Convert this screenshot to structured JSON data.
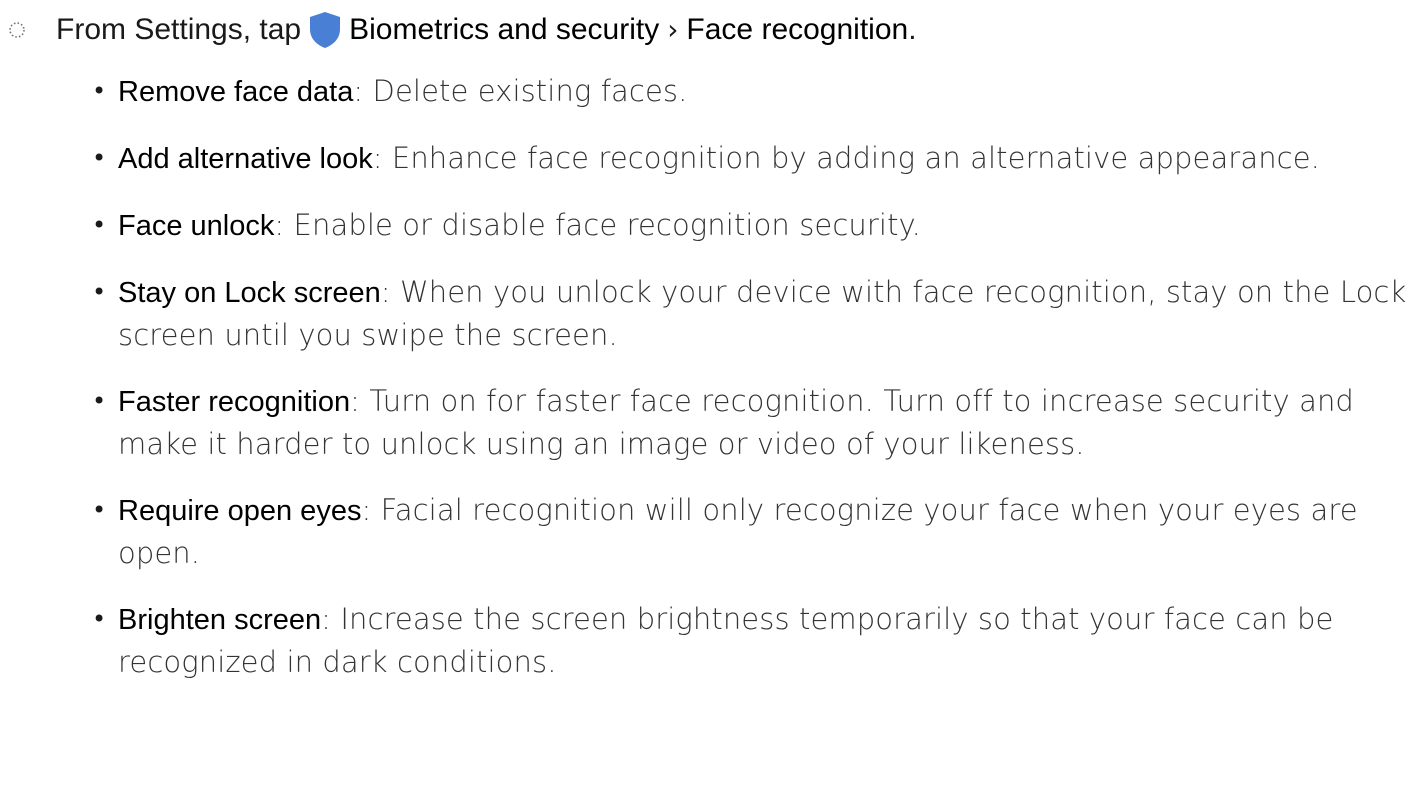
{
  "step": {
    "prefix": "From Settings, tap",
    "menu_item": "Biometrics and security",
    "separator": "›",
    "submenu_item": "Face recognition",
    "suffix": "."
  },
  "icons": {
    "step_marker": "dotted-circle-icon",
    "settings_icon": "shield-icon",
    "shield_color": "#4a7fd6"
  },
  "options": [
    {
      "term": "Remove face data",
      "desc": ": Delete existing faces."
    },
    {
      "term": "Add alternative look",
      "desc": ": Enhance face recognition by adding an alternative appearance."
    },
    {
      "term": "Face unlock",
      "desc": ": Enable or disable face recognition security."
    },
    {
      "term": "Stay on Lock screen",
      "desc": ": When you unlock your device with face recognition, stay on the Lock screen until you swipe the screen."
    },
    {
      "term": "Faster recognition",
      "desc": ": Turn on for faster face recognition. Turn off to increase security and make it harder to unlock using an image or video of your likeness."
    },
    {
      "term": "Require open eyes",
      "desc": ": Facial recognition will only recognize your face when your eyes are open."
    },
    {
      "term": "Brighten screen",
      "desc": ": Increase the screen brightness temporarily so that your face can be recognized in dark conditions."
    }
  ]
}
